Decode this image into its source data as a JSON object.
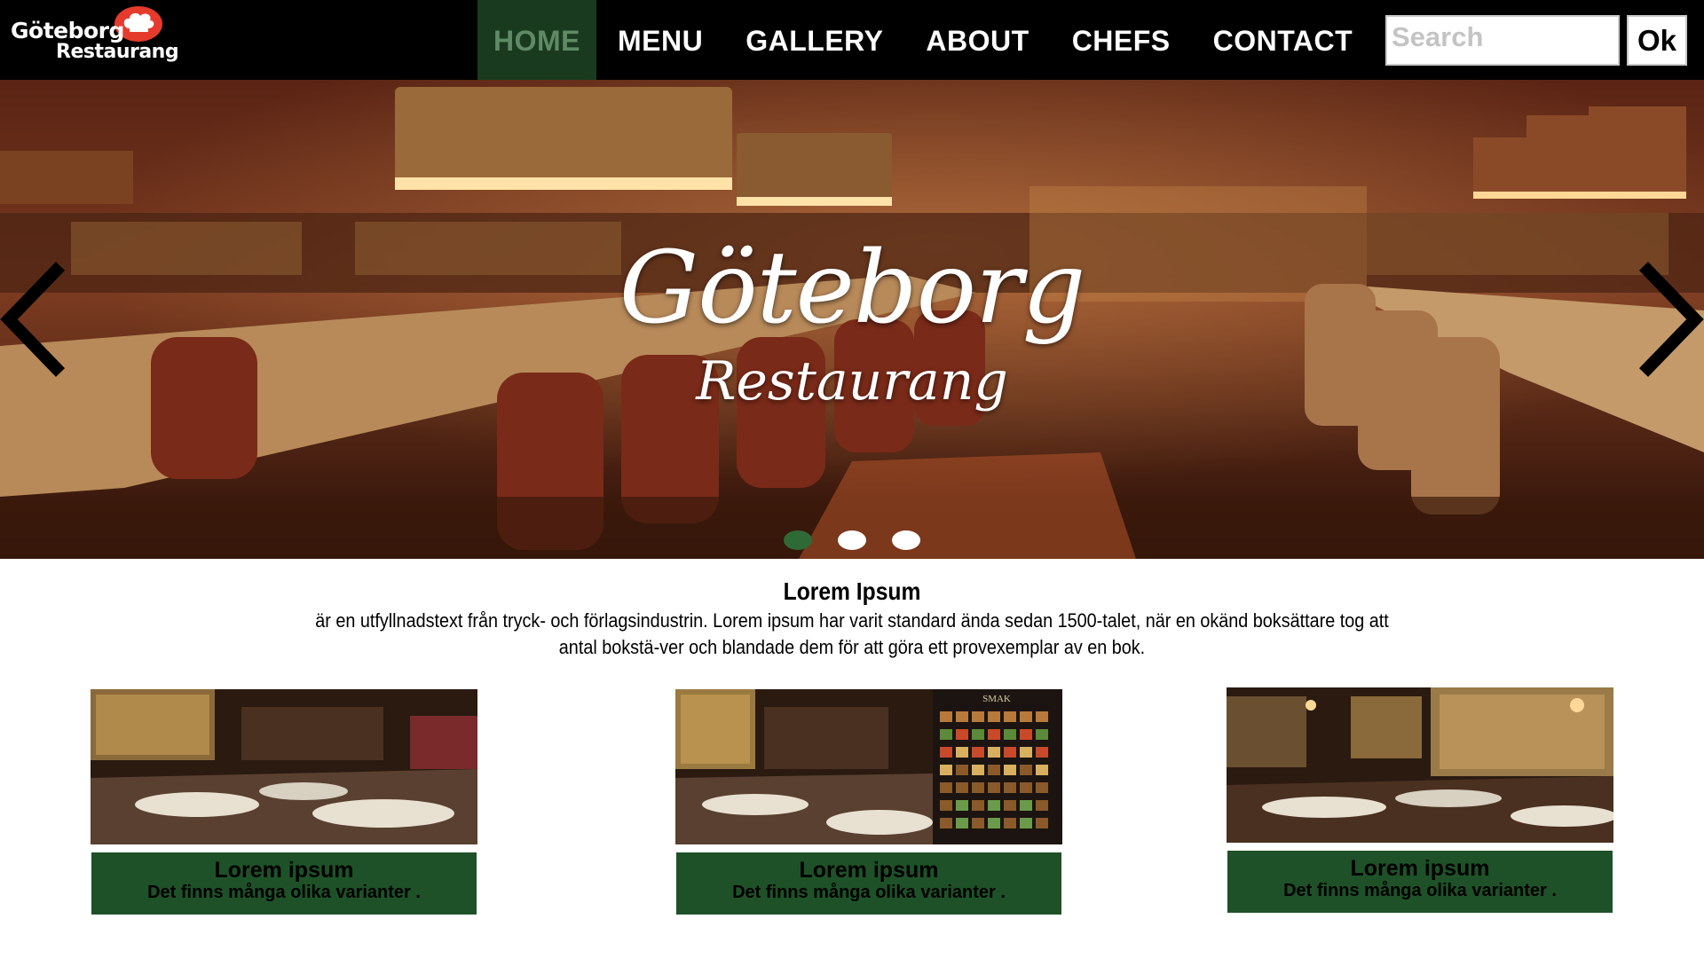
{
  "logo": {
    "line1": "Göteborg",
    "line2": "Restaurang",
    "icon": "chef-hat-icon"
  },
  "nav": {
    "items": [
      {
        "label": "HOME",
        "active": true
      },
      {
        "label": "MENU"
      },
      {
        "label": "GALLERY"
      },
      {
        "label": "ABOUT"
      },
      {
        "label": "CHEFS"
      },
      {
        "label": "CONTACT"
      }
    ]
  },
  "search": {
    "placeholder": "Search",
    "value": "",
    "button_label": "Ok"
  },
  "hero": {
    "title": "Göteborg",
    "subtitle": "Restaurang",
    "prev_icon": "chevron-left-icon",
    "next_icon": "chevron-right-icon",
    "slides": 3,
    "active_slide": 1
  },
  "intro": {
    "title": "Lorem Ipsum",
    "text": "är en utfyllnadstext från tryck- och förlagsindustrin. Lorem ipsum har varit standard ända sedan 1500-talet, när en okänd boksättare tog att antal bokstä-ver och blandade dem för att göra ett provexemplar av en bok."
  },
  "cards": [
    {
      "title": "Lorem ipsum",
      "text": "Det finns många olika varianter ."
    },
    {
      "title": "Lorem ipsum",
      "text": "Det finns många olika varianter .",
      "image_sign": "SMAK"
    },
    {
      "title": "Lorem ipsum",
      "text": "Det finns många olika varianter ."
    }
  ],
  "colors": {
    "nav_bg": "#000000",
    "nav_active_bg": "#1a3a1f",
    "nav_active_text": "#5f8a65",
    "card_caption_bg": "#1e5127",
    "dot_active": "#2f6a36"
  }
}
